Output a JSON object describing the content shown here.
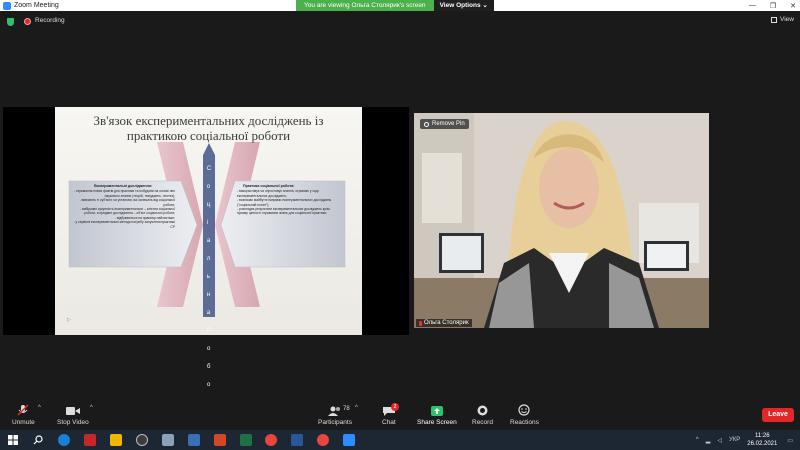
{
  "window": {
    "title": "Zoom Meeting",
    "controls": [
      "—",
      "❐",
      "✕"
    ]
  },
  "share_banner": {
    "viewing_text": "You are viewing Ольга Столярик's screen",
    "view_options": "View Options ⌄"
  },
  "topbar": {
    "recording_label": "Recording",
    "view_label": "View"
  },
  "slide": {
    "title": "Зв'язок експериментальних досліджень із практикою соціальної роботи",
    "left_heading": "Експериментальні дослідження:",
    "left_items": [
      "- отримання нових фактів для практики та побудови на основі них наукового знання (теорій, тверджень, гіпотез);",
      "- вивчають ті суб'єкти чи установи, які залежать від соціальної роботи;",
      "- вибірково сукупність експериментально – клієнти соціальної роботи, а предмет дослідження – об'єкт соціальної роботи;",
      "- відбуваються на практиці найчастіше;",
      "- у сервісні експериментальні методи потребу залучення практики СР"
    ],
    "right_heading": "Практика соціальної роботи:",
    "right_items": [
      "- використовує чи спростовує знання, отримані у ході експериментальних досліджень;",
      "- визначає майбутні напрями експериментальних досліджень (\"соціальний попит\");",
      "- розглядає результати експериментальних досліджень крізь призму цінності отриманих знань для соціальної практики;"
    ],
    "pillar_top": [
      "С",
      "о",
      "ц",
      "і",
      "а",
      "л",
      "ь",
      "н",
      "а"
    ],
    "pillar_bottom": [
      "Р",
      "о",
      "б",
      "о",
      "т",
      "а"
    ],
    "play_glyph": "▷"
  },
  "video": {
    "remove_pin": "Remove Pin",
    "participant_name": "Ольга Столярик"
  },
  "toolbar": {
    "unmute": "Unmute",
    "stop_video": "Stop Video",
    "participants": "Participants",
    "participants_count": "78",
    "chat": "Chat",
    "chat_badge": "2",
    "share_screen": "Share Screen",
    "record": "Record",
    "reactions": "Reactions",
    "leave": "Leave"
  },
  "taskbar": {
    "lang": "УКР",
    "time": "11:26",
    "date": "26.02.2021"
  },
  "colors": {
    "accent_green": "#4cb04b",
    "leave_red": "#e02828",
    "share_green": "#27c46c",
    "arrow_blue": "#5c6c96"
  }
}
